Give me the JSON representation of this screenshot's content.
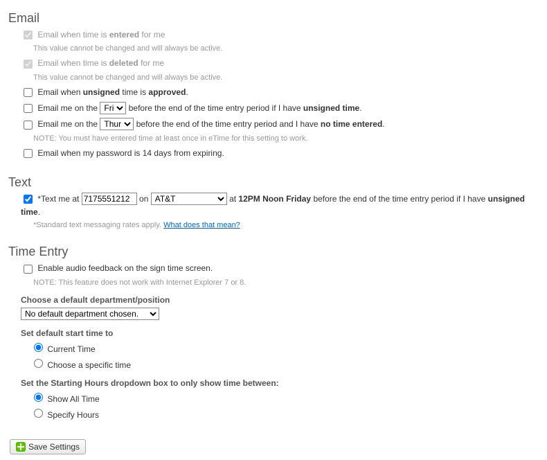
{
  "email": {
    "heading": "Email",
    "entered": {
      "prefix": "Email when time is ",
      "bold": "entered",
      "suffix": " for me",
      "note": "This value cannot be changed and will always be active."
    },
    "deleted": {
      "prefix": "Email when time is ",
      "bold": "deleted",
      "suffix": " for me",
      "note": "This value cannot be changed and will always be active."
    },
    "unsigned_approved": {
      "prefix": "Email when ",
      "bold1": "unsigned",
      "mid": " time is ",
      "bold2": "approved",
      "suffix": "."
    },
    "reminder_unsigned": {
      "prefix": "Email me on the ",
      "day": "Fri",
      "mid": " before the end of the time entry period if I have ",
      "bold": "unsigned time",
      "suffix": "."
    },
    "reminder_notime": {
      "prefix": "Email me on the ",
      "day": "Thur",
      "mid": " before the end of the time entry period and I have ",
      "bold": "no time entered",
      "suffix": ".",
      "note": "NOTE: You must have entered time at least once in eTime for this setting to work."
    },
    "password_expiring": "Email when my password is 14 days from expiring."
  },
  "text": {
    "heading": "Text",
    "star": "*",
    "prefix": "Text me at ",
    "phone": "7175551212",
    "on": " on ",
    "carrier": "AT&T",
    "at": " at ",
    "bold1": "12PM Noon Friday",
    "mid": " before the end of the time entry period if I have ",
    "bold2": "unsigned time",
    "suffix": ".",
    "rates": "*Standard text messaging rates apply. ",
    "rates_link": "What does that mean?"
  },
  "timeentry": {
    "heading": "Time Entry",
    "audio": {
      "label": "Enable audio feedback on the sign time screen.",
      "note": "NOTE: This feature does not work with Internet Explorer 7 or 8."
    },
    "dept_head": "Choose a default department/position",
    "dept_value": "No default department chosen.",
    "start_head": "Set default start time to",
    "start_current": "Current Time",
    "start_specific": "Choose a specific time",
    "hours_head": "Set the Starting Hours dropdown box to only show time between:",
    "hours_all": "Show All Time",
    "hours_specify": "Specify Hours"
  },
  "save_label": "Save Settings"
}
